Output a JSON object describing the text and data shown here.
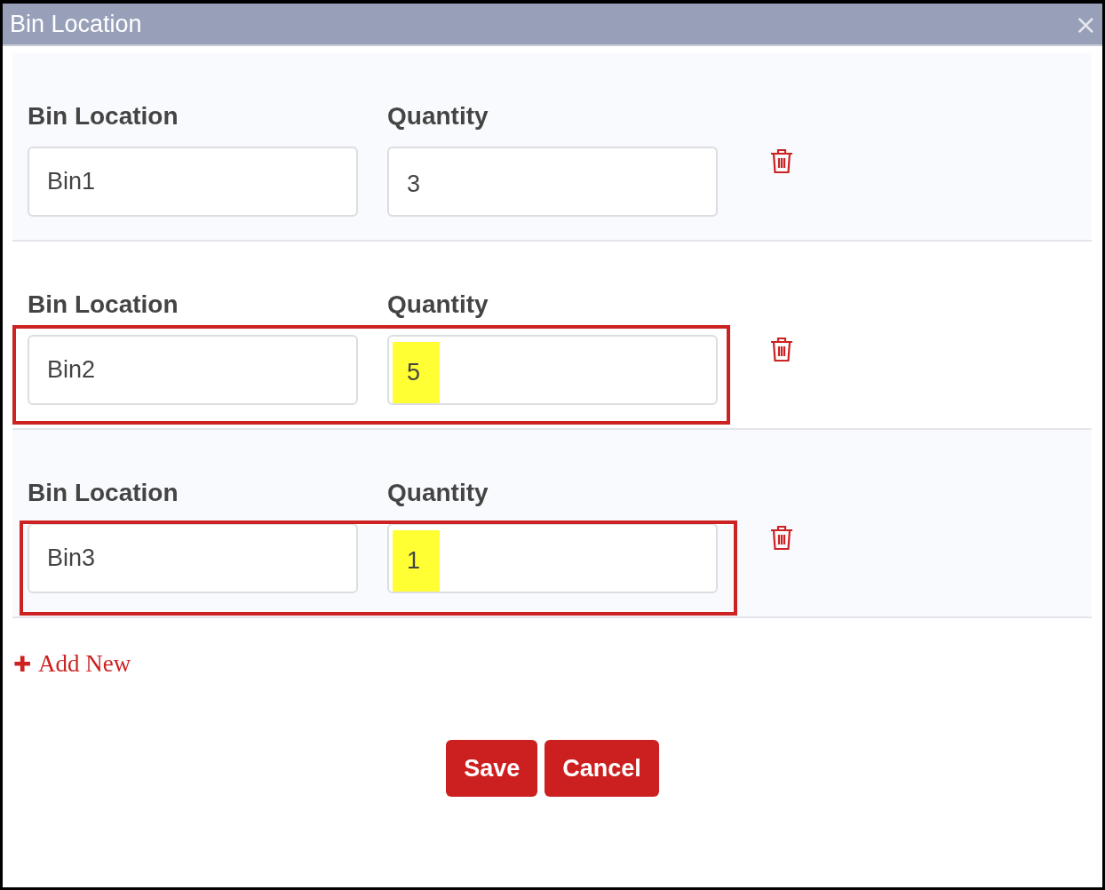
{
  "window": {
    "title": "Bin Location",
    "close": "×"
  },
  "rows": [
    {
      "bin_label": "Bin Location",
      "quantity_label": "Quantity",
      "bin": "Bin1",
      "quantity": "3",
      "highlighted": false
    },
    {
      "bin_label": "Bin Location",
      "quantity_label": "Quantity",
      "bin": "Bin2",
      "quantity": "5",
      "highlighted": true
    },
    {
      "bin_label": "Bin Location",
      "quantity_label": "Quantity",
      "bin": "Bin3",
      "quantity": "1",
      "highlighted": true
    }
  ],
  "add_new": {
    "icon": "✚",
    "label": "Add New"
  },
  "buttons": [
    "Save",
    "Cancel"
  ]
}
